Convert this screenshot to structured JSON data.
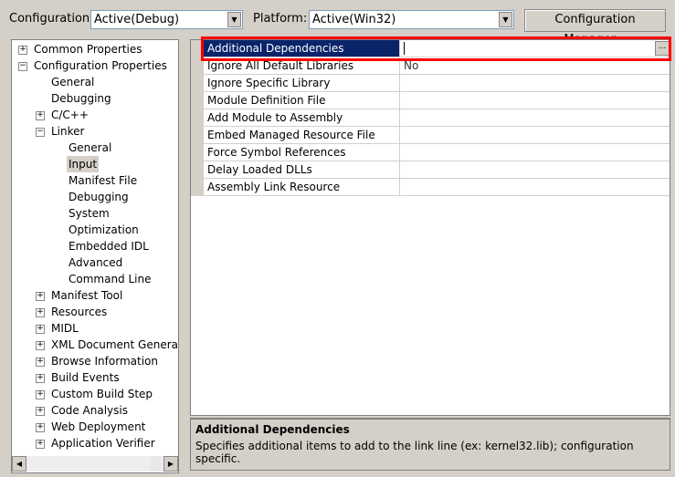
{
  "header": {
    "configuration_label": "Configuration:",
    "configuration_value": "Active(Debug)",
    "platform_label": "Platform:",
    "platform_value": "Active(Win32)",
    "config_manager_button": "Configuration Manager..."
  },
  "tree": [
    {
      "label": "Common Properties",
      "level": 0,
      "expander": "+"
    },
    {
      "label": "Configuration Properties",
      "level": 0,
      "expander": "-"
    },
    {
      "label": "General",
      "level": 1
    },
    {
      "label": "Debugging",
      "level": 1
    },
    {
      "label": "C/C++",
      "level": 1,
      "expander": "+"
    },
    {
      "label": "Linker",
      "level": 1,
      "expander": "-"
    },
    {
      "label": "General",
      "level": 2
    },
    {
      "label": "Input",
      "level": 2,
      "selected": true
    },
    {
      "label": "Manifest File",
      "level": 2
    },
    {
      "label": "Debugging",
      "level": 2
    },
    {
      "label": "System",
      "level": 2
    },
    {
      "label": "Optimization",
      "level": 2
    },
    {
      "label": "Embedded IDL",
      "level": 2
    },
    {
      "label": "Advanced",
      "level": 2
    },
    {
      "label": "Command Line",
      "level": 2
    },
    {
      "label": "Manifest Tool",
      "level": 1,
      "expander": "+"
    },
    {
      "label": "Resources",
      "level": 1,
      "expander": "+"
    },
    {
      "label": "MIDL",
      "level": 1,
      "expander": "+"
    },
    {
      "label": "XML Document Generator",
      "level": 1,
      "expander": "+"
    },
    {
      "label": "Browse Information",
      "level": 1,
      "expander": "+"
    },
    {
      "label": "Build Events",
      "level": 1,
      "expander": "+"
    },
    {
      "label": "Custom Build Step",
      "level": 1,
      "expander": "+"
    },
    {
      "label": "Code Analysis",
      "level": 1,
      "expander": "+"
    },
    {
      "label": "Web Deployment",
      "level": 1,
      "expander": "+"
    },
    {
      "label": "Application Verifier",
      "level": 1,
      "expander": "+"
    }
  ],
  "properties": [
    {
      "name": "Additional Dependencies",
      "value": "",
      "selected": true
    },
    {
      "name": "Ignore All Default Libraries",
      "value": "No"
    },
    {
      "name": "Ignore Specific Library",
      "value": ""
    },
    {
      "name": "Module Definition File",
      "value": ""
    },
    {
      "name": "Add Module to Assembly",
      "value": ""
    },
    {
      "name": "Embed Managed Resource File",
      "value": ""
    },
    {
      "name": "Force Symbol References",
      "value": ""
    },
    {
      "name": "Delay Loaded DLLs",
      "value": ""
    },
    {
      "name": "Assembly Link Resource",
      "value": ""
    }
  ],
  "ellipsis_button": "...",
  "description": {
    "title": "Additional Dependencies",
    "text": "Specifies additional items to add to the link line (ex: kernel32.lib); configuration specific."
  },
  "colors": {
    "selection": "#0a246a",
    "highlight_box": "#ff0000"
  }
}
